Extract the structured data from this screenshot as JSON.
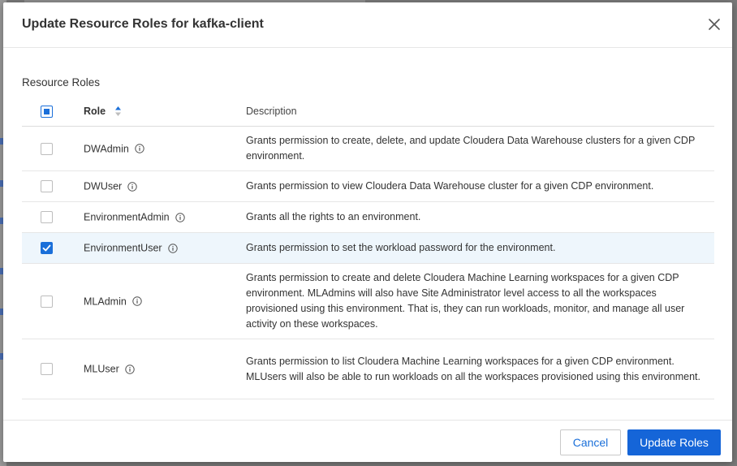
{
  "modal": {
    "title": "Update Resource Roles for kafka-client",
    "section_title": "Resource Roles"
  },
  "table": {
    "headers": {
      "role": "Role",
      "description": "Description"
    },
    "rows": [
      {
        "role": "DWAdmin",
        "description": "Grants permission to create, delete, and update Cloudera Data Warehouse clusters for a given CDP environment.",
        "checked": false
      },
      {
        "role": "DWUser",
        "description": "Grants permission to view Cloudera Data Warehouse cluster for a given CDP environment.",
        "checked": false
      },
      {
        "role": "EnvironmentAdmin",
        "description": "Grants all the rights to an environment.",
        "checked": false
      },
      {
        "role": "EnvironmentUser",
        "description": "Grants permission to set the workload password for the environment.",
        "checked": true
      },
      {
        "role": "MLAdmin",
        "description": "Grants permission to create and delete Cloudera Machine Learning workspaces for a given CDP environment. MLAdmins will also have Site Administrator level access to all the workspaces provisioned using this environment. That is, they can run workloads, monitor, and manage all user activity on these workspaces.",
        "checked": false
      },
      {
        "role": "MLUser",
        "description": "Grants permission to list Cloudera Machine Learning workspaces for a given CDP environment. MLUsers will also be able to run workloads on all the workspaces provisioned using this environment.",
        "checked": false
      }
    ]
  },
  "footer": {
    "cancel_label": "Cancel",
    "submit_label": "Update Roles"
  },
  "colors": {
    "accent": "#1565d8",
    "selected_row": "#eef6fc"
  },
  "icons": {
    "close": "close-icon",
    "info": "info-icon",
    "sort": "sort-icon",
    "check": "checkmark-icon"
  }
}
